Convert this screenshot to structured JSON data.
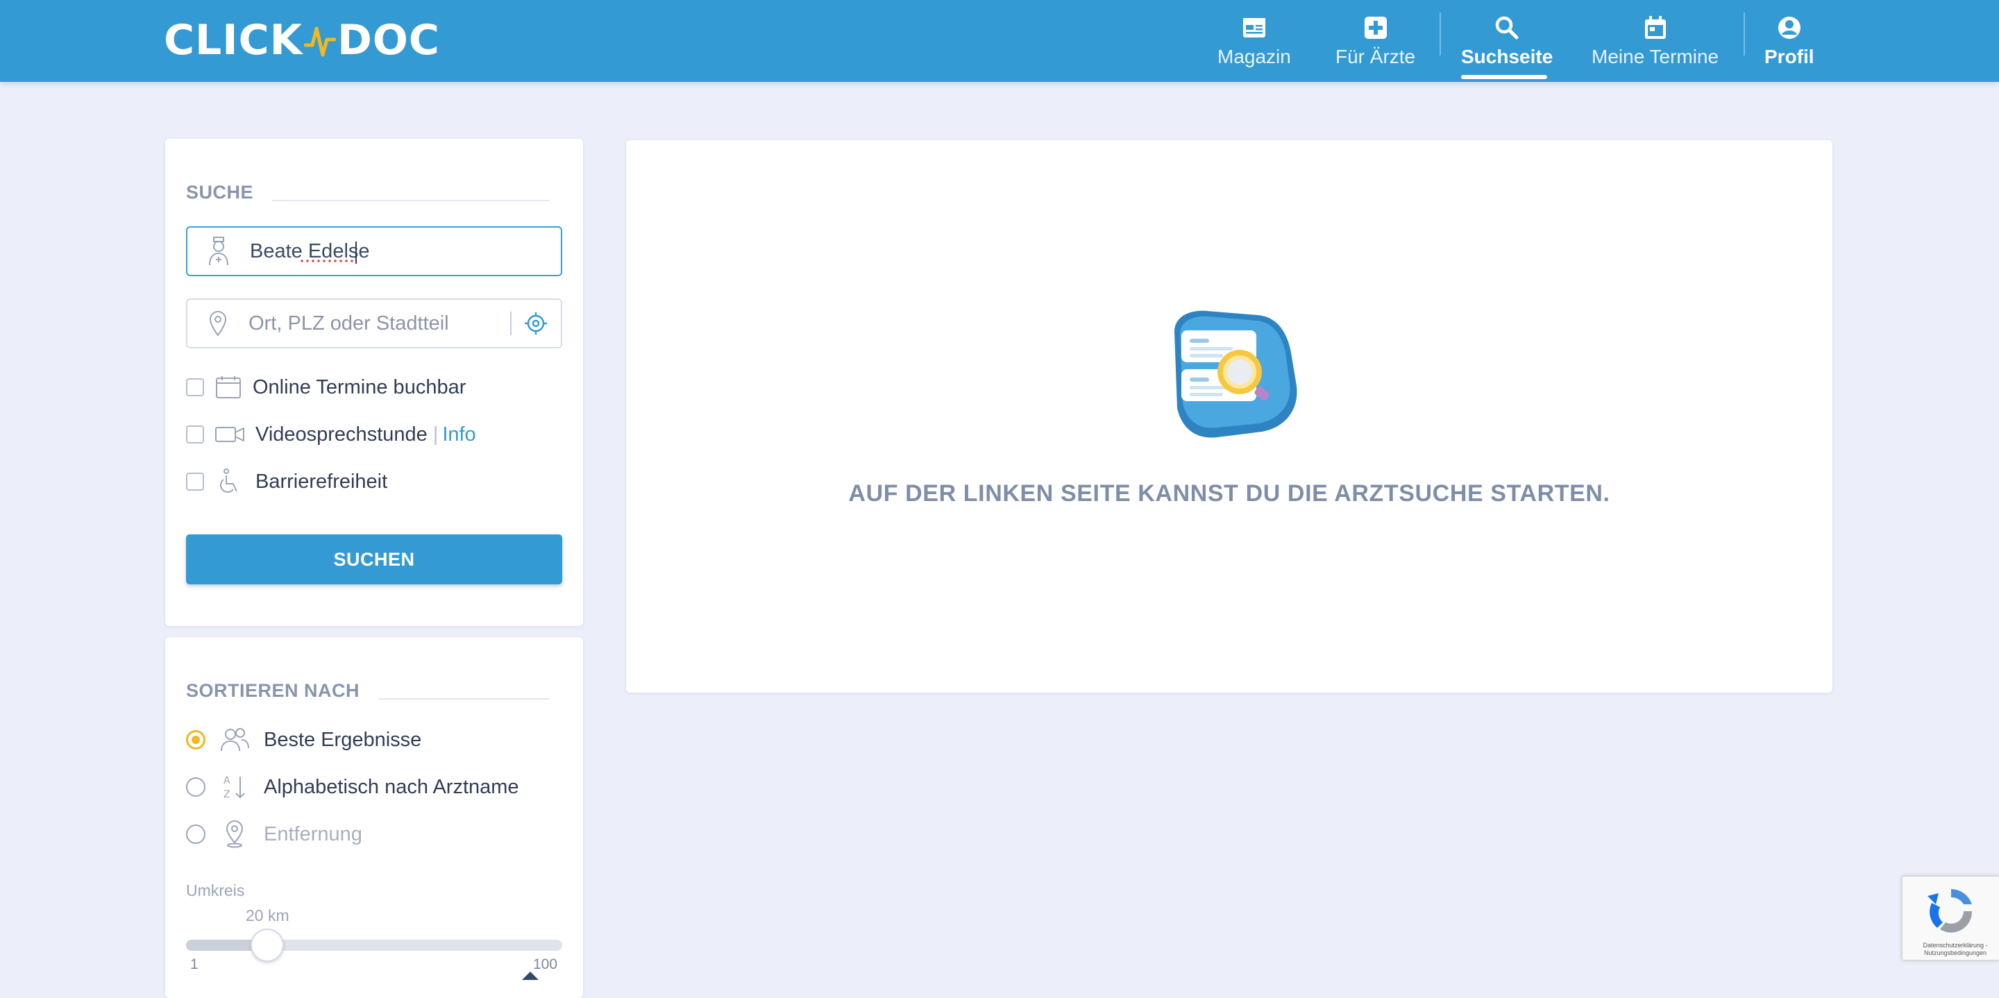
{
  "header": {
    "logo_left": "CLICK",
    "logo_right": "DOC",
    "nav": [
      {
        "label": "Magazin",
        "icon": "newspaper-icon"
      },
      {
        "label": "Für Ärzte",
        "icon": "medical-cross-icon"
      },
      {
        "label": "Suchseite",
        "icon": "search-icon",
        "active": true
      },
      {
        "label": "Meine Termine",
        "icon": "calendar-icon"
      },
      {
        "label": "Profil",
        "icon": "account-circle-icon"
      }
    ]
  },
  "search": {
    "title": "SUCHE",
    "name_value": "Beate Edelse",
    "location_placeholder": "Ort, PLZ oder Stadtteil",
    "filters": {
      "online": "Online Termine buchbar",
      "video": "Videosprechstunde",
      "video_sep": "|",
      "video_info": "Info",
      "accessible": "Barrierefreiheit"
    },
    "button": "SUCHEN"
  },
  "sort": {
    "title": "SORTIEREN NACH",
    "options": [
      {
        "label": "Beste Ergebnisse",
        "checked": true
      },
      {
        "label": "Alphabetisch nach Arztname",
        "checked": false
      },
      {
        "label": "Entfernung",
        "checked": false,
        "disabled": true
      }
    ],
    "radius_label": "Umkreis",
    "radius_value": "20 km",
    "radius_km": 20,
    "radius_min": "1",
    "radius_max": "100"
  },
  "results": {
    "empty_message": "AUF DER LINKEN SEITE KANNST DU DIE ARZTSUCHE STARTEN."
  },
  "recaptcha": {
    "privacy": "Datenschutzerklärung",
    "sep": " - ",
    "terms": "Nutzungsbedingungen"
  },
  "colors": {
    "brand": "#349ad4",
    "logo_accent": "#f2b81f",
    "radio_checked": "#f2b81f",
    "background": "#eceff9"
  }
}
